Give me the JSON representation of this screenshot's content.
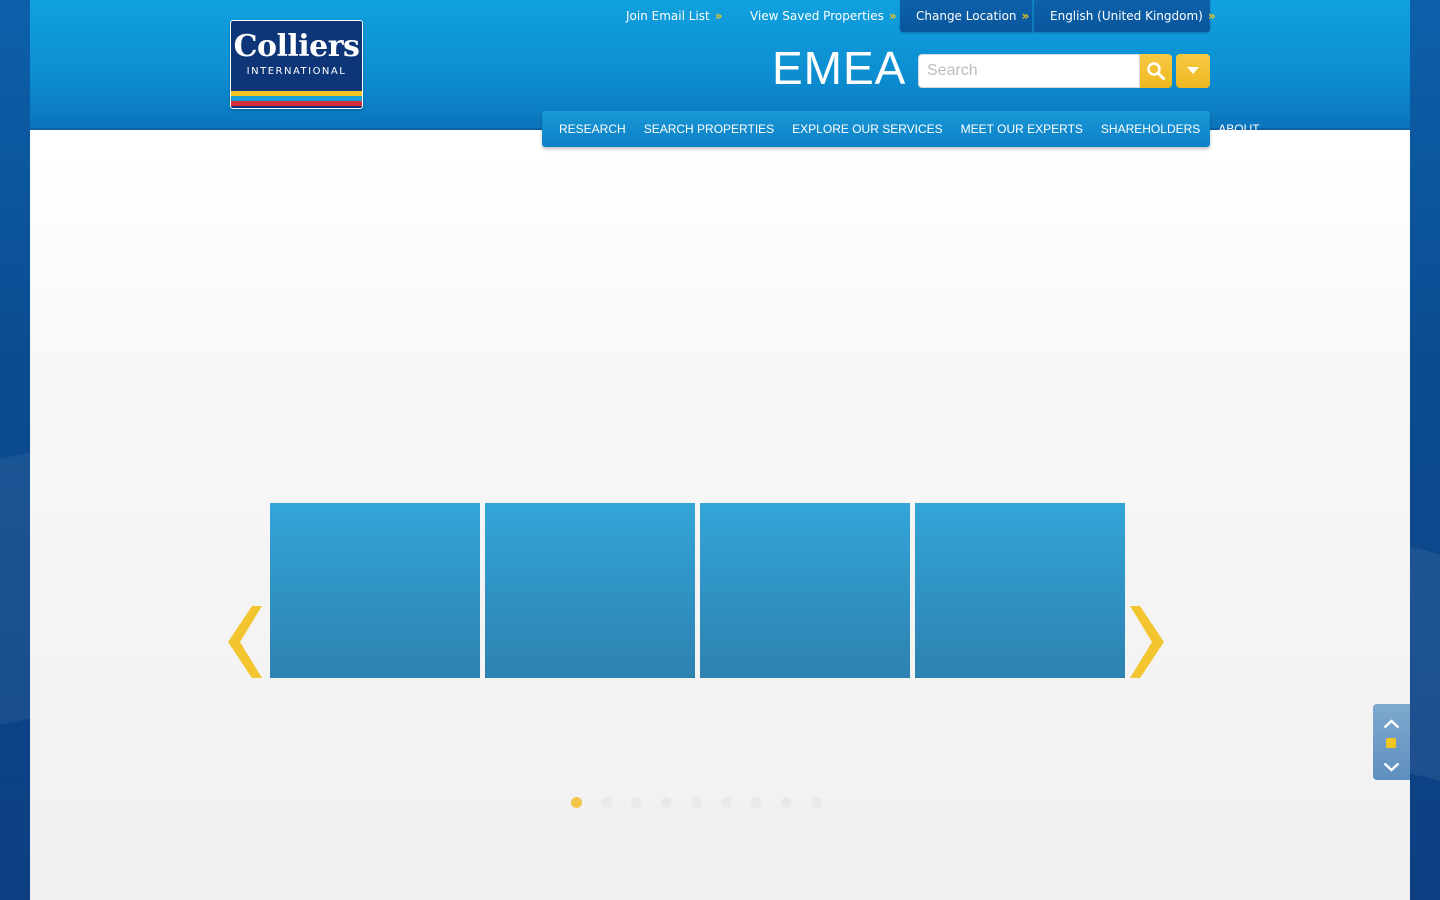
{
  "header": {
    "logo": {
      "wordmark": "Colliers",
      "subtitle": "INTERNATIONAL"
    },
    "util_links": [
      {
        "label": "Join Email List",
        "chevron": "»"
      },
      {
        "label": "View Saved Properties",
        "chevron": "»"
      },
      {
        "label": "Change Location",
        "chevron": "»"
      },
      {
        "label": "English (United Kingdom)",
        "chevron": "»"
      }
    ],
    "region": "EMEA :",
    "search": {
      "placeholder": "Search",
      "value": "",
      "button_icon": "search-icon",
      "dropdown_icon": "caret-down-icon"
    }
  },
  "nav": {
    "items": [
      "RESEARCH",
      "SEARCH PROPERTIES",
      "EXPLORE OUR SERVICES",
      "MEET OUR EXPERTS",
      "SHAREHOLDERS",
      "ABOUT"
    ]
  },
  "carousel": {
    "prev_icon": "chevron-left-icon",
    "next_icon": "chevron-right-icon",
    "tile_count": 4,
    "page_count": 9,
    "active_page": 1
  },
  "scroller": {
    "up_icon": "chevron-up-icon",
    "down_icon": "chevron-down-icon"
  },
  "colors": {
    "brand_navy": "#0d3577",
    "header_blue": "#0d8fd2",
    "accent_yellow": "#f3c520",
    "tile_blue": "#2f8fc0"
  }
}
